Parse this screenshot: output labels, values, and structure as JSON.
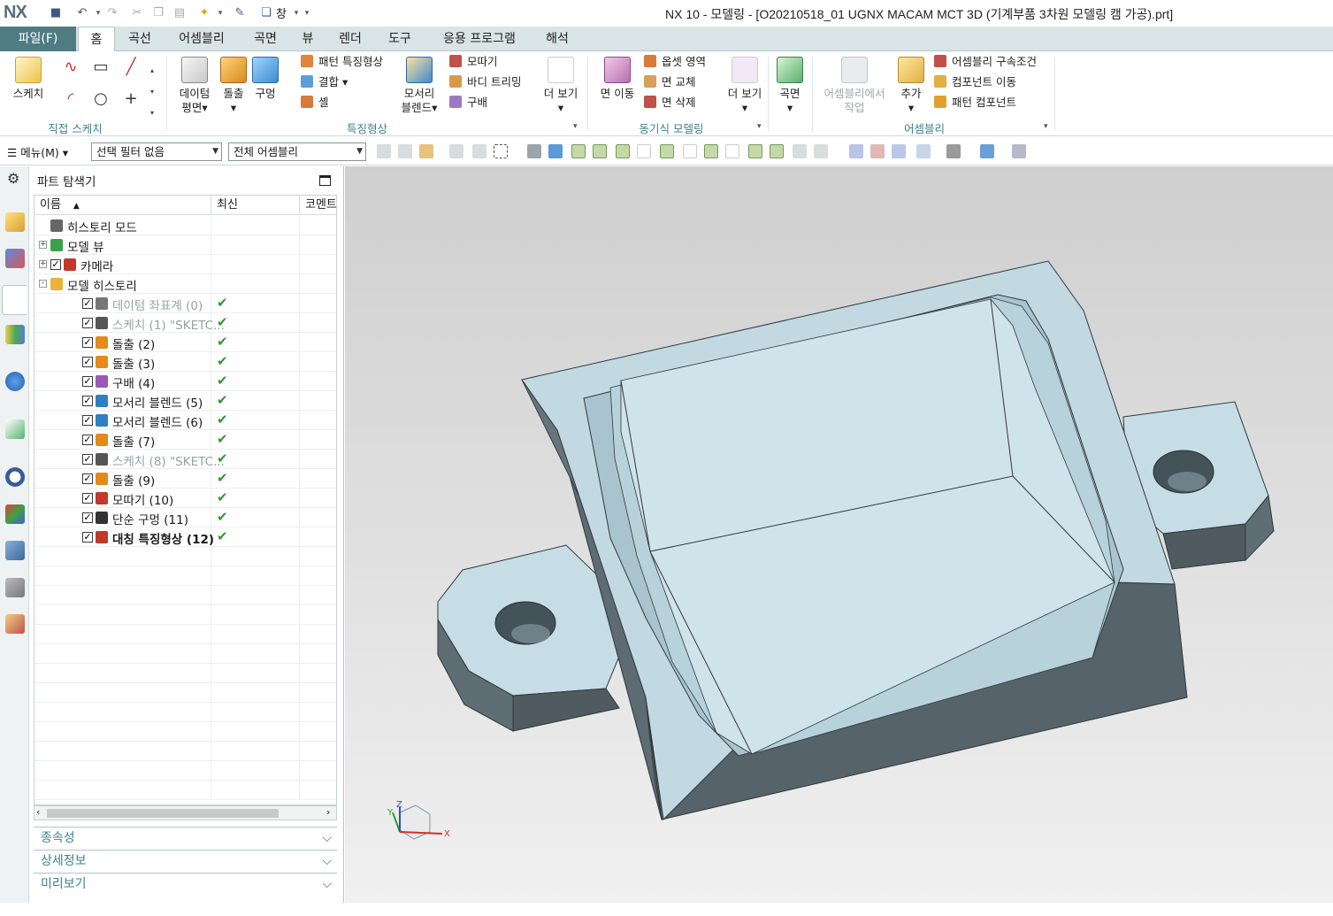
{
  "window": {
    "logo": "NX",
    "title": "NX 10 - 모델링 - [O20210518_01 UGNX MACAM MCT 3D (기계부품 3차원 모델링 캠 가공).prt]",
    "window_menu_label": "창"
  },
  "menu": {
    "file": "파일(F)",
    "tabs": [
      "홈",
      "곡선",
      "어셈블리",
      "곡면",
      "뷰",
      "렌더",
      "도구",
      "응용 프로그램",
      "해석"
    ],
    "active_tab": "홈"
  },
  "ribbon": {
    "sketch": "스케치",
    "direct_sketch_group": "직접 스케치",
    "datum_plane": "데이텀",
    "datum_plane_2": "평면",
    "extrude": "돌출",
    "hole": "구멍",
    "pattern_feature": "패턴 특징형상",
    "unite": "결합",
    "shell": "셸",
    "edge_blend": "모서리",
    "edge_blend_2": "블렌드",
    "chamfer": "모따기",
    "trim_body": "바디 트리밍",
    "draft": "구배",
    "more": "더 보기",
    "feature_group": "특징형상",
    "move_face": "면 이동",
    "offset_region": "옵셋 영역",
    "replace_face": "면 교체",
    "delete_face": "면 삭제",
    "more2": "더 보기",
    "sync_group": "동기식 모델링",
    "surface": "곡면",
    "work_in_assembly": "어셈블리에서",
    "work_in_assembly_2": "작업",
    "add": "추가",
    "assembly_constraints": "어셈블리 구속조건",
    "move_component": "컴포넌트 이동",
    "pattern_component": "패턴 컴포넌트",
    "assembly_group": "어셈블리"
  },
  "toolbar": {
    "menu": "메뉴(M)",
    "selection_filter": "선택 필터 없음",
    "scope": "전체 어셈블리"
  },
  "navigator": {
    "title": "파트 탐색기",
    "columns": [
      "이름",
      "최신",
      "코멘트"
    ],
    "rows": [
      {
        "label": "히스토리 모드",
        "indent": 0,
        "grey": false,
        "bold": false,
        "checked": false,
        "latest": false,
        "icon": "clock-icon",
        "color": "#666666"
      },
      {
        "label": "모델 뷰",
        "indent": 0,
        "grey": false,
        "bold": false,
        "checked": false,
        "latest": false,
        "icon": "model-view-icon",
        "color": "#3aa04a",
        "expander": "+"
      },
      {
        "label": "카메라",
        "indent": 0,
        "grey": false,
        "bold": false,
        "checked": true,
        "latest": false,
        "icon": "camera-icon",
        "color": "#c0392b",
        "expander": "+"
      },
      {
        "label": "모델 히스토리",
        "indent": 0,
        "grey": false,
        "bold": false,
        "checked": false,
        "latest": false,
        "icon": "folder-icon",
        "color": "#e8b339",
        "expander": "-"
      },
      {
        "label": "데이텀 좌표계 (0)",
        "indent": 1,
        "grey": true,
        "bold": false,
        "checked": true,
        "latest": true,
        "icon": "datum-csys-icon",
        "color": "#777777"
      },
      {
        "label": "스케치 (1) \"SKETC...",
        "indent": 1,
        "grey": true,
        "bold": false,
        "checked": true,
        "latest": true,
        "icon": "sketch-icon",
        "color": "#555555"
      },
      {
        "label": "돌출 (2)",
        "indent": 1,
        "grey": false,
        "bold": false,
        "checked": true,
        "latest": true,
        "icon": "extrude-icon",
        "color": "#e38a1b"
      },
      {
        "label": "돌출 (3)",
        "indent": 1,
        "grey": false,
        "bold": false,
        "checked": true,
        "latest": true,
        "icon": "extrude-icon",
        "color": "#e38a1b"
      },
      {
        "label": "구배 (4)",
        "indent": 1,
        "grey": false,
        "bold": false,
        "checked": true,
        "latest": true,
        "icon": "draft-icon",
        "color": "#9b59b6"
      },
      {
        "label": "모서리 블렌드 (5)",
        "indent": 1,
        "grey": false,
        "bold": false,
        "checked": true,
        "latest": true,
        "icon": "edge-blend-icon",
        "color": "#2f80c0"
      },
      {
        "label": "모서리 블렌드 (6)",
        "indent": 1,
        "grey": false,
        "bold": false,
        "checked": true,
        "latest": true,
        "icon": "edge-blend-icon",
        "color": "#2f80c0"
      },
      {
        "label": "돌출 (7)",
        "indent": 1,
        "grey": false,
        "bold": false,
        "checked": true,
        "latest": true,
        "icon": "extrude-icon",
        "color": "#e38a1b"
      },
      {
        "label": "스케치 (8) \"SKETC...",
        "indent": 1,
        "grey": true,
        "bold": false,
        "checked": true,
        "latest": true,
        "icon": "sketch-icon",
        "color": "#555555"
      },
      {
        "label": "돌출 (9)",
        "indent": 1,
        "grey": false,
        "bold": false,
        "checked": true,
        "latest": true,
        "icon": "extrude-icon",
        "color": "#e38a1b"
      },
      {
        "label": "모따기 (10)",
        "indent": 1,
        "grey": false,
        "bold": false,
        "checked": true,
        "latest": true,
        "icon": "chamfer-icon",
        "color": "#c0392b"
      },
      {
        "label": "단순 구멍 (11)",
        "indent": 1,
        "grey": false,
        "bold": false,
        "checked": true,
        "latest": true,
        "icon": "hole-icon",
        "color": "#333333"
      },
      {
        "label": "대칭 특징형상 (12)",
        "indent": 1,
        "grey": false,
        "bold": true,
        "checked": true,
        "latest": true,
        "icon": "mirror-feature-icon",
        "color": "#c0392b"
      }
    ],
    "sections": [
      "종속성",
      "상세정보",
      "미리보기"
    ]
  },
  "viewport": {
    "axis_x": "X",
    "axis_y": "Y",
    "axis_z": "Z"
  },
  "colors": {
    "accent": "#4f7b83",
    "group_label": "#3f7f8c",
    "part_top": "#c8e0e8",
    "part_side_dark": "#5d6b72",
    "check_green": "#2e9a2e"
  }
}
